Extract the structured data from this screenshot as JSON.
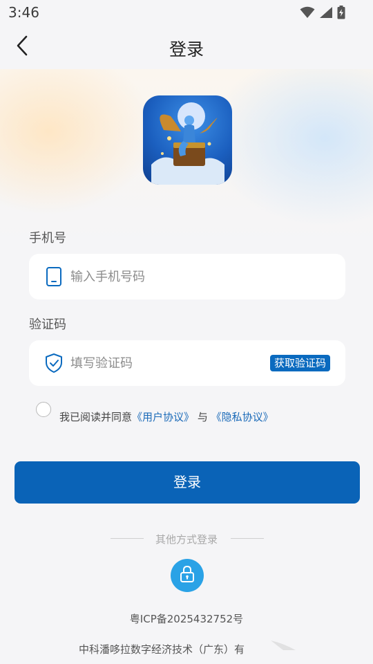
{
  "status_bar": {
    "time": "3:46",
    "icons": [
      "wifi-icon",
      "cellular-signal-icon",
      "battery-charging-icon"
    ]
  },
  "nav": {
    "back_icon": "chevron-left-icon",
    "title": "登录"
  },
  "form": {
    "phone": {
      "label": "手机号",
      "placeholder": "输入手机号码",
      "value": "",
      "icon": "phone-icon"
    },
    "code": {
      "label": "验证码",
      "placeholder": "填写验证码",
      "value": "",
      "icon": "shield-check-icon",
      "button_label": "获取验证码"
    },
    "agreement": {
      "checked": false,
      "prefix": "我已阅读并同意",
      "user_agreement": "《用户协议》",
      "joiner": "与",
      "privacy_policy": "《隐私协议》"
    },
    "submit_label": "登录"
  },
  "other_login": {
    "label": "其他方式登录",
    "option_icon": "lock-icon"
  },
  "footer": {
    "icp": "粤ICP备2025432752号",
    "company": "中科潘哆拉数字经济技术（广东）有"
  },
  "colors": {
    "primary": "#0a63b7",
    "link": "#1a6ab8",
    "lock_button": "#2aa2e6",
    "background": "#f5f5f7"
  }
}
